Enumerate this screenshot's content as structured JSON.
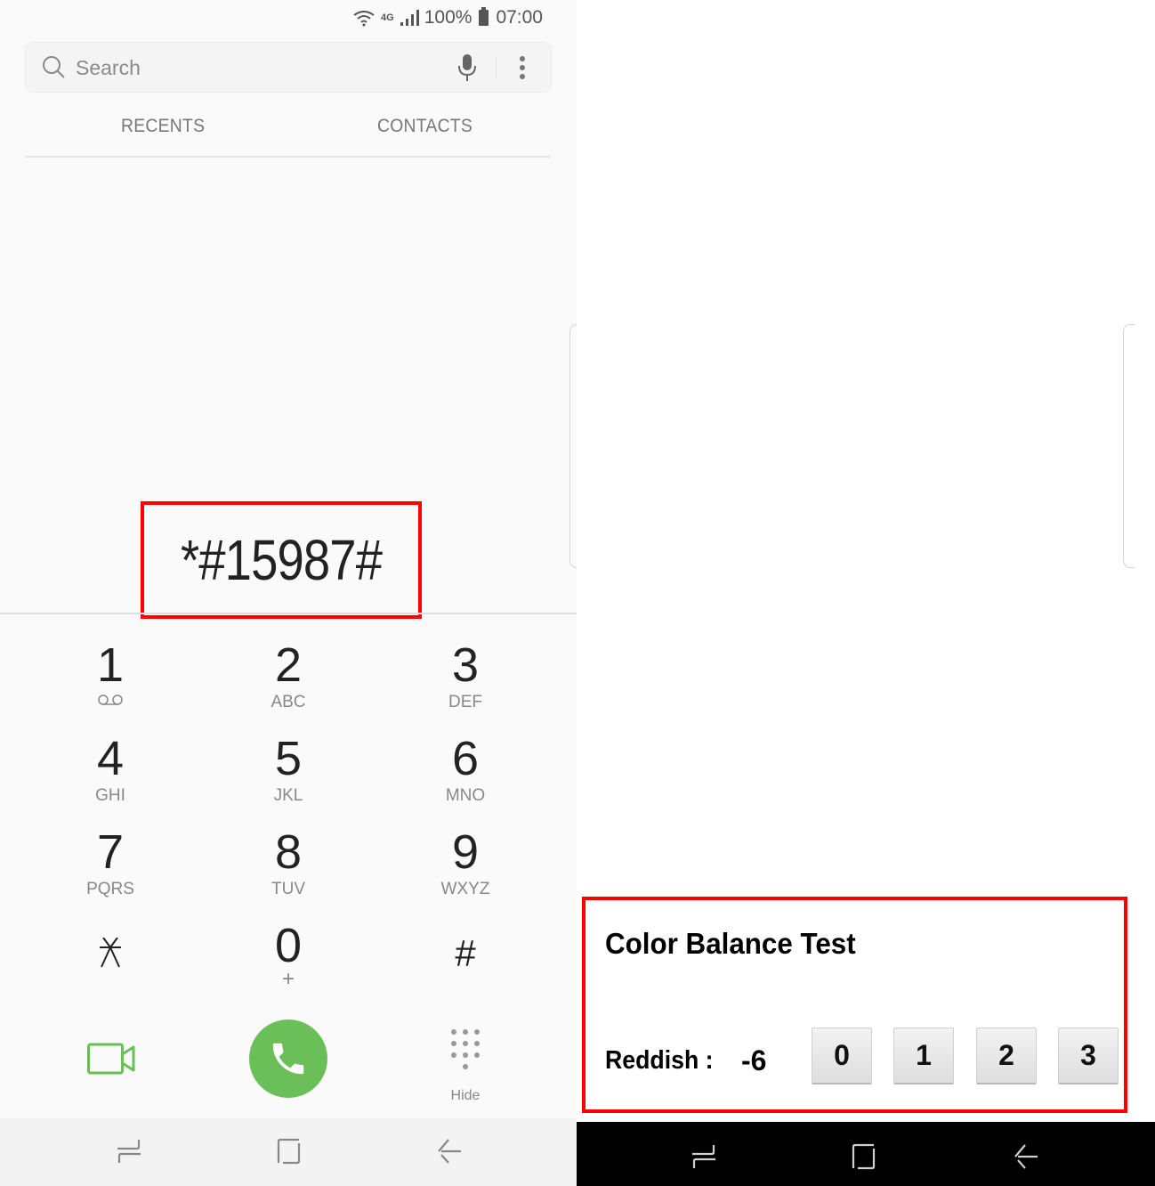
{
  "status_bar": {
    "wifi_icon": "wifi-icon",
    "network": "4G",
    "signal_icon": "signal-icon",
    "battery": "100%",
    "time": "07:00"
  },
  "search": {
    "placeholder": "Search",
    "value": ""
  },
  "tabs": [
    {
      "label": "RECENTS"
    },
    {
      "label": "CONTACTS"
    }
  ],
  "dialed_number": "*#15987#",
  "keypad": [
    {
      "digit": "1",
      "letters": ""
    },
    {
      "digit": "2",
      "letters": "ABC"
    },
    {
      "digit": "3",
      "letters": "DEF"
    },
    {
      "digit": "4",
      "letters": "GHI"
    },
    {
      "digit": "5",
      "letters": "JKL"
    },
    {
      "digit": "6",
      "letters": "MNO"
    },
    {
      "digit": "7",
      "letters": "PQRS"
    },
    {
      "digit": "8",
      "letters": "TUV"
    },
    {
      "digit": "9",
      "letters": "WXYZ"
    },
    {
      "digit": "⁎",
      "letters": ""
    },
    {
      "digit": "0",
      "letters": "+"
    },
    {
      "digit": "#",
      "letters": ""
    }
  ],
  "actions": {
    "hide_label": "Hide"
  },
  "color_balance": {
    "title": "Color Balance Test",
    "label": "Reddish :",
    "value": "-6",
    "buttons": [
      "0",
      "1",
      "2",
      "3"
    ]
  },
  "colors": {
    "call_green": "#6bbf59",
    "highlight_red": "#ff0000"
  }
}
